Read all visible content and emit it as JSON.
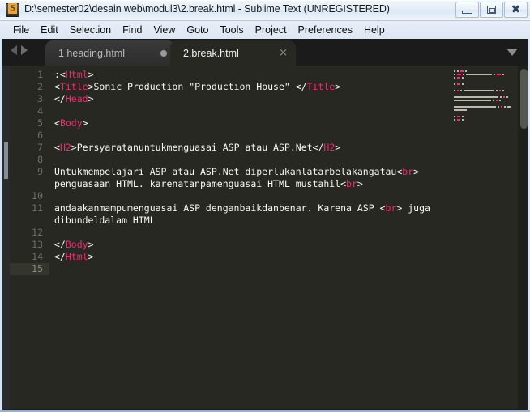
{
  "window": {
    "title": "D:\\semester02\\desain web\\modul3\\2.break.html - Sublime Text (UNREGISTERED)",
    "app_icon_name": "sublime-text-icon",
    "controls": {
      "minimize": "Minimize",
      "maximize": "Restore",
      "close": "Close"
    }
  },
  "menu": {
    "items": [
      {
        "label": "File"
      },
      {
        "label": "Edit"
      },
      {
        "label": "Selection"
      },
      {
        "label": "Find"
      },
      {
        "label": "View"
      },
      {
        "label": "Goto"
      },
      {
        "label": "Tools"
      },
      {
        "label": "Project"
      },
      {
        "label": "Preferences"
      },
      {
        "label": "Help"
      }
    ]
  },
  "tabs": {
    "nav_back": "Previous tab",
    "nav_forward": "Next tab",
    "overflow": "Show tab list",
    "items": [
      {
        "label": "1 heading.html",
        "active": false,
        "modified": true,
        "close": ""
      },
      {
        "label": "2.break.html",
        "active": true,
        "modified": false,
        "close": "×"
      }
    ]
  },
  "editor": {
    "current_line": 15,
    "line_numbers": [
      "1",
      "2",
      "3",
      "4",
      "5",
      "6",
      "7",
      "8",
      "9",
      "10",
      "11",
      "12",
      "13",
      "14",
      "15"
    ],
    "lines": [
      {
        "num": "1",
        "segments": [
          {
            "t": ":",
            "c": "punct"
          },
          {
            "t": "<",
            "c": "punct"
          },
          {
            "t": "Html",
            "c": "tag"
          },
          {
            "t": ">",
            "c": "punct"
          }
        ]
      },
      {
        "num": "2",
        "segments": [
          {
            "t": "<",
            "c": "punct"
          },
          {
            "t": "Title",
            "c": "tag"
          },
          {
            "t": ">",
            "c": "punct"
          },
          {
            "t": "Sonic Production \"Production House\" ",
            "c": "txt"
          },
          {
            "t": "</",
            "c": "punct"
          },
          {
            "t": "Title",
            "c": "tag"
          },
          {
            "t": ">",
            "c": "punct"
          }
        ]
      },
      {
        "num": "3",
        "segments": [
          {
            "t": "</",
            "c": "punct"
          },
          {
            "t": "Head",
            "c": "tag"
          },
          {
            "t": ">",
            "c": "punct"
          }
        ]
      },
      {
        "num": "4",
        "segments": []
      },
      {
        "num": "5",
        "segments": [
          {
            "t": "<",
            "c": "punct"
          },
          {
            "t": "Body",
            "c": "tag"
          },
          {
            "t": ">",
            "c": "punct"
          }
        ]
      },
      {
        "num": "6",
        "segments": []
      },
      {
        "num": "7",
        "segments": [
          {
            "t": "<",
            "c": "punct"
          },
          {
            "t": "H2",
            "c": "tag"
          },
          {
            "t": ">",
            "c": "punct"
          },
          {
            "t": "Persyaratanuntukmenguasai ASP atau ASP.Net",
            "c": "txt"
          },
          {
            "t": "</",
            "c": "punct"
          },
          {
            "t": "H2",
            "c": "tag"
          },
          {
            "t": ">",
            "c": "punct"
          }
        ]
      },
      {
        "num": "8",
        "segments": []
      },
      {
        "num": "9",
        "segments": [
          {
            "t": "Untukmempelajari ASP atau ASP.Net diperlukanlatarbelakangatau",
            "c": "txt"
          },
          {
            "t": "<",
            "c": "punct"
          },
          {
            "t": "br",
            "c": "tag"
          },
          {
            "t": ">",
            "c": "punct"
          }
        ]
      },
      {
        "num": "",
        "segments": [
          {
            "t": "penguasaan HTML. karenatanpamenguasai HTML mustahil",
            "c": "txt"
          },
          {
            "t": "<",
            "c": "punct"
          },
          {
            "t": "br",
            "c": "tag"
          },
          {
            "t": ">",
            "c": "punct"
          }
        ]
      },
      {
        "num": "10",
        "segments": []
      },
      {
        "num": "11",
        "segments": [
          {
            "t": "andaakanmampumenguasai ASP denganbaikdanbenar. Karena ASP ",
            "c": "txt"
          },
          {
            "t": "<",
            "c": "punct"
          },
          {
            "t": "br",
            "c": "tag"
          },
          {
            "t": ">",
            "c": "punct"
          },
          {
            "t": " juga",
            "c": "txt"
          }
        ]
      },
      {
        "num": "",
        "segments": [
          {
            "t": "dibundeldalam HTML",
            "c": "txt"
          }
        ]
      },
      {
        "num": "12",
        "segments": []
      },
      {
        "num": "13",
        "segments": [
          {
            "t": "</",
            "c": "punct"
          },
          {
            "t": "Body",
            "c": "tag"
          },
          {
            "t": ">",
            "c": "punct"
          }
        ]
      },
      {
        "num": "14",
        "segments": [
          {
            "t": "</",
            "c": "punct"
          },
          {
            "t": "Html",
            "c": "tag"
          },
          {
            "t": ">",
            "c": "punct"
          }
        ]
      },
      {
        "num": "15",
        "segments": []
      }
    ]
  },
  "colors": {
    "editor_bg": "#272822",
    "tag": "#f92672",
    "text": "#f7f7f2",
    "gutter_text": "#6e7066",
    "chrome_bg": "#1b1b1b",
    "title_bar": "#e4edf8"
  }
}
